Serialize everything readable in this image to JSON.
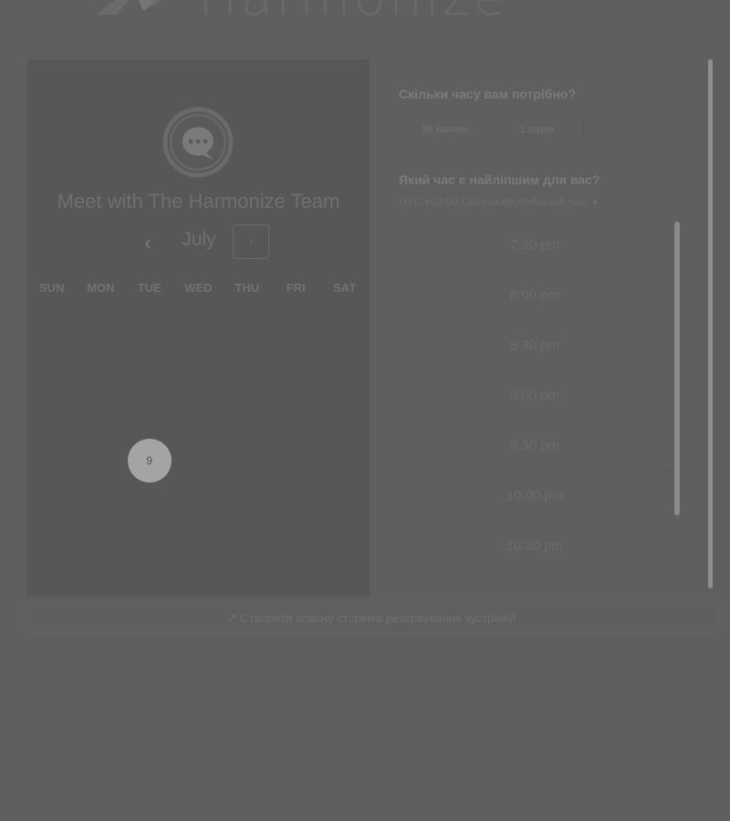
{
  "brand": {
    "name": "Harmonize"
  },
  "calendar": {
    "title": "Meet with The Harmonize Team",
    "month": "July",
    "prev_label": "‹",
    "next_label": "›",
    "weekdays": [
      "SUN",
      "MON",
      "TUE",
      "WED",
      "THU",
      "FRI",
      "SAT"
    ],
    "weeks": [
      [
        "",
        "",
        "",
        "",
        "",
        "",
        ""
      ],
      [
        "",
        "",
        "",
        "",
        "",
        "",
        ""
      ],
      [
        "",
        "",
        "",
        "",
        "",
        "",
        ""
      ],
      [
        "",
        "",
        "9",
        "",
        "",
        "",
        ""
      ],
      [
        "",
        "",
        "",
        "",
        "",
        "",
        ""
      ],
      [
        "",
        "",
        "",
        "",
        "",
        "",
        ""
      ]
    ],
    "selected_day": "9"
  },
  "duration": {
    "question": "Скільки часу вам потрібно?",
    "options": [
      "30 хвилин",
      "1 годин"
    ]
  },
  "time": {
    "question": "Який час є найліпшим для вас?",
    "timezone": "UTC +02:00 Східноєвропейський час",
    "slots": [
      "7:30 pm",
      "8:00 pm",
      "8:30 pm",
      "9:00 pm",
      "9:30 pm",
      "10:00 pm",
      "10:30 pm"
    ]
  },
  "footer": {
    "link_icon": "↗",
    "link_text": "Створити власну сторінка резервування зустрічей"
  }
}
